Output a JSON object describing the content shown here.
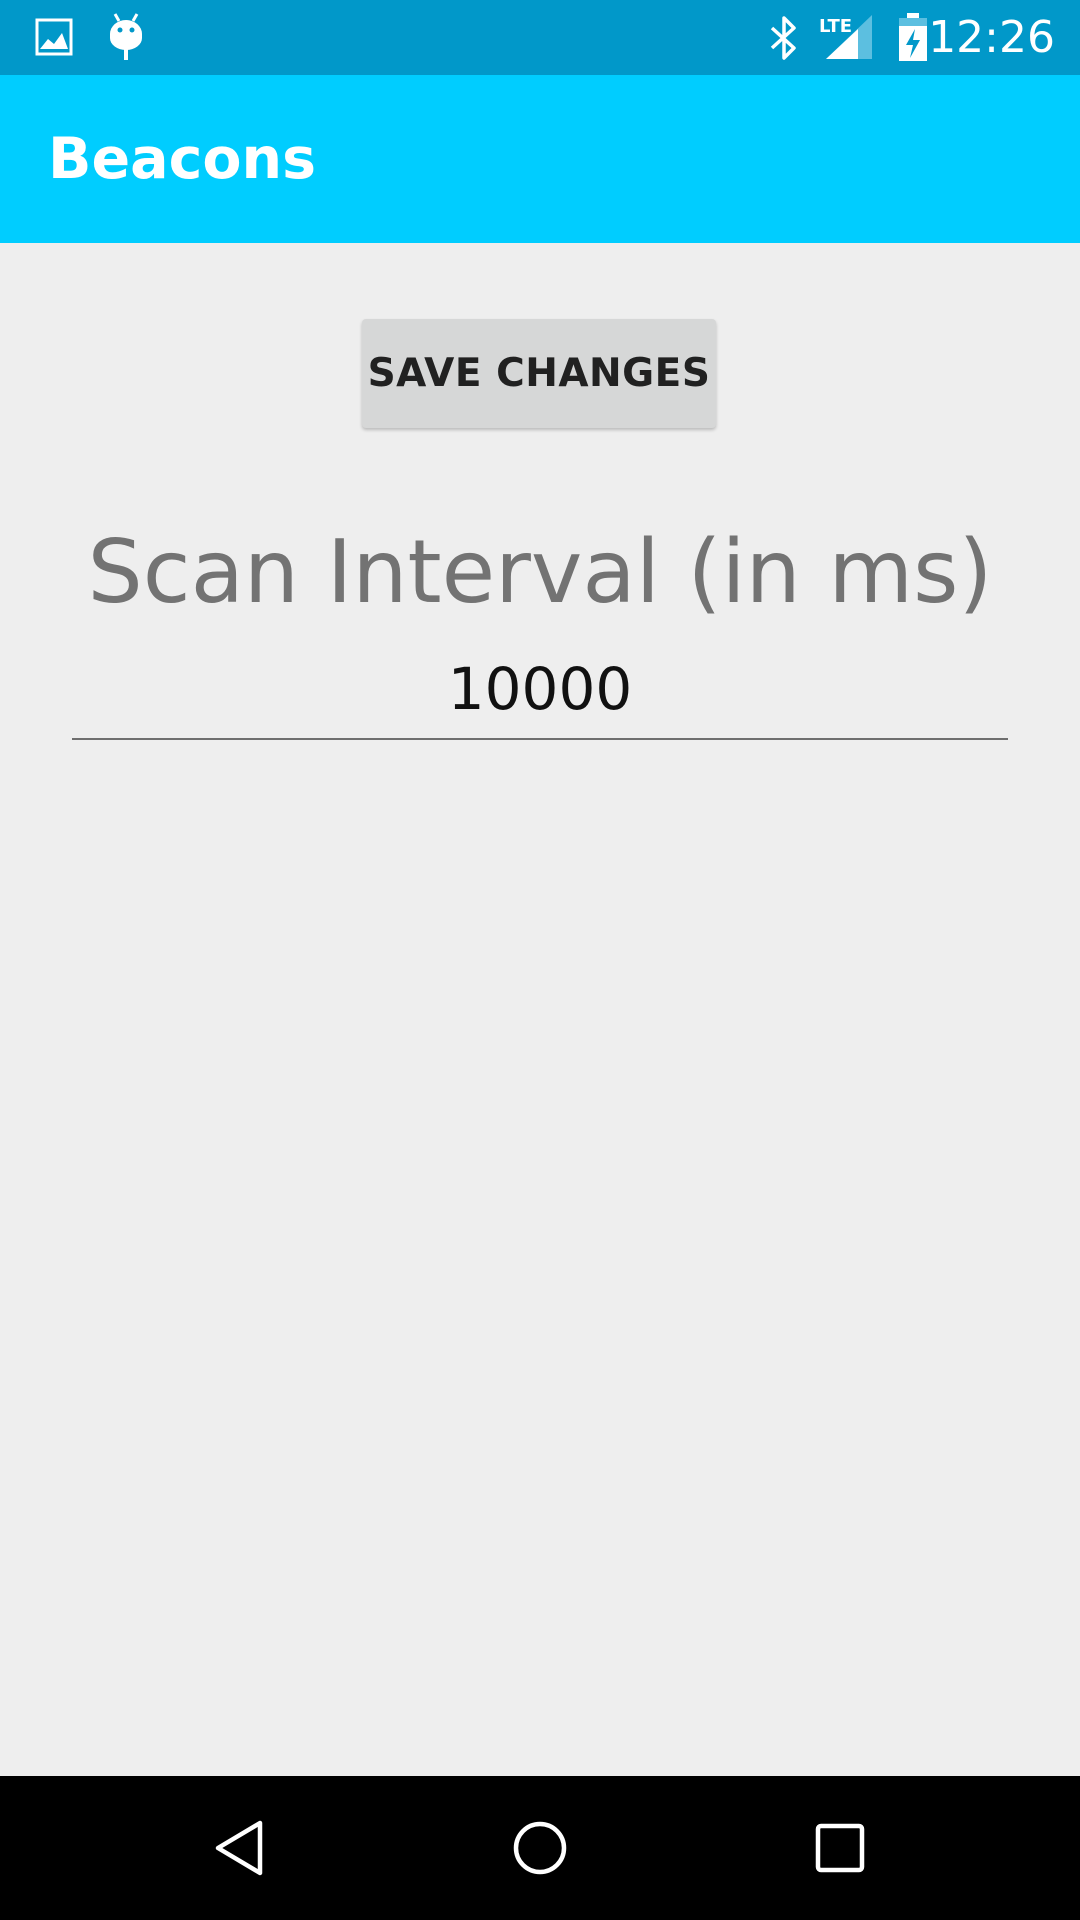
{
  "status_bar": {
    "time": "12:26",
    "left_icons": [
      "image-icon",
      "android-debug-icon"
    ],
    "right_icons": [
      "bluetooth-icon",
      "lte-signal-icon",
      "battery-charging-icon"
    ],
    "network_label": "LTE"
  },
  "app_bar": {
    "title": "Beacons"
  },
  "main": {
    "save_button_label": "SAVE CHANGES",
    "scan_interval_label": "Scan Interval (in ms)",
    "scan_interval_value": "10000"
  },
  "nav_bar": {
    "icons": [
      "back-icon",
      "home-icon",
      "recents-icon"
    ]
  },
  "colors": {
    "status_bar": "#0198c9",
    "app_bar": "#00cdff",
    "background": "#eeeeee",
    "button": "#d6d7d7"
  }
}
